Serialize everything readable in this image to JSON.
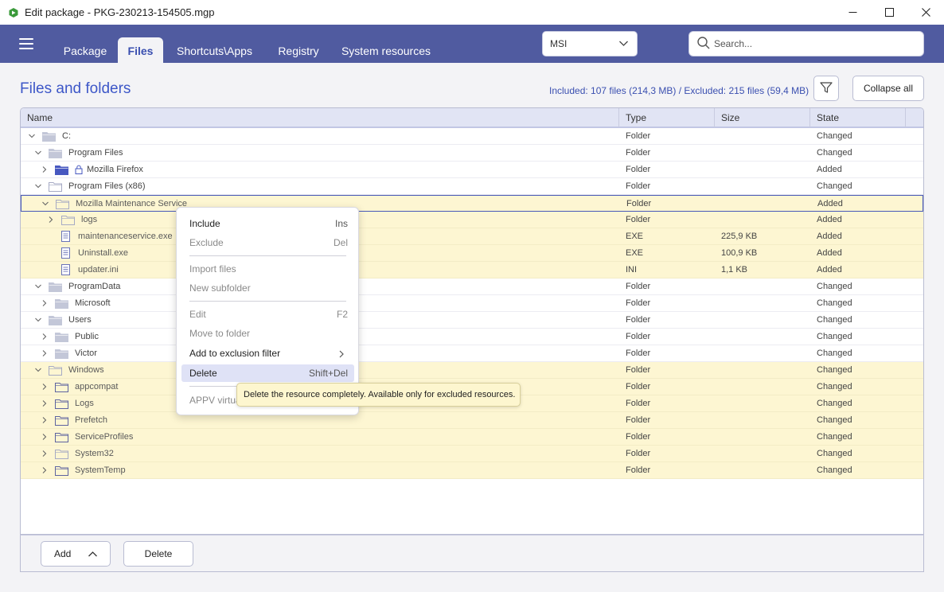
{
  "window": {
    "title": "Edit package - PKG-230213-154505.mgp",
    "min_icon": "minimize-icon",
    "max_icon": "maximize-icon",
    "close_icon": "close-icon"
  },
  "nav": {
    "tabs": [
      {
        "label": "Package",
        "active": false
      },
      {
        "label": "Files",
        "active": true
      },
      {
        "label": "Shortcuts\\Apps",
        "active": false
      },
      {
        "label": "Registry",
        "active": false
      },
      {
        "label": "System resources",
        "active": false
      }
    ],
    "format_select": "MSI",
    "search_placeholder": "Search..."
  },
  "header": {
    "title": "Files and folders",
    "counts": "Included: 107 files (214,3 MB) / Excluded: 215 files (59,4 MB)",
    "collapse_all": "Collapse all"
  },
  "columns": [
    "Name",
    "Type",
    "Size",
    "State"
  ],
  "rows": [
    {
      "name": "C:",
      "type": "Folder",
      "size": "",
      "state": "Changed",
      "level": 0,
      "chev": "down",
      "icon": "folder-grey",
      "hl": false
    },
    {
      "name": "Program Files",
      "type": "Folder",
      "size": "",
      "state": "Changed",
      "level": 1,
      "chev": "down",
      "icon": "folder-grey",
      "hl": false
    },
    {
      "name": "Mozilla Firefox",
      "type": "Folder",
      "size": "",
      "state": "Added",
      "level": 2,
      "chev": "right",
      "icon": "folder-blue",
      "lock": true,
      "hl": false
    },
    {
      "name": "Program Files (x86)",
      "type": "Folder",
      "size": "",
      "state": "Changed",
      "level": 1,
      "chev": "down",
      "icon": "folder-outline",
      "hl": false
    },
    {
      "name": "Mozilla Maintenance Service",
      "type": "Folder",
      "size": "",
      "state": "Added",
      "level": 2,
      "chev": "down",
      "icon": "folder-outline",
      "hl": true,
      "sel": true
    },
    {
      "name": "logs",
      "type": "Folder",
      "size": "",
      "state": "Added",
      "level": 3,
      "chev": "right",
      "icon": "folder-outline",
      "hl": true
    },
    {
      "name": "maintenanceservice.exe",
      "type": "EXE",
      "size": "225,9 KB",
      "state": "Added",
      "level": 3,
      "chev": "",
      "icon": "file",
      "hl": true
    },
    {
      "name": "Uninstall.exe",
      "type": "EXE",
      "size": "100,9 KB",
      "state": "Added",
      "level": 3,
      "chev": "",
      "icon": "file",
      "hl": true
    },
    {
      "name": "updater.ini",
      "type": "INI",
      "size": "1,1 KB",
      "state": "Added",
      "level": 3,
      "chev": "",
      "icon": "file",
      "hl": true
    },
    {
      "name": "ProgramData",
      "type": "Folder",
      "size": "",
      "state": "Changed",
      "level": 1,
      "chev": "down",
      "icon": "folder-grey",
      "hl": false
    },
    {
      "name": "Microsoft",
      "type": "Folder",
      "size": "",
      "state": "Changed",
      "level": 2,
      "chev": "right",
      "icon": "folder-grey",
      "hl": false
    },
    {
      "name": "Users",
      "type": "Folder",
      "size": "",
      "state": "Changed",
      "level": 1,
      "chev": "down",
      "icon": "folder-grey",
      "hl": false
    },
    {
      "name": "Public",
      "type": "Folder",
      "size": "",
      "state": "Changed",
      "level": 2,
      "chev": "right",
      "icon": "folder-grey",
      "hl": false
    },
    {
      "name": "Victor",
      "type": "Folder",
      "size": "",
      "state": "Changed",
      "level": 2,
      "chev": "right",
      "icon": "folder-grey",
      "hl": false
    },
    {
      "name": "Windows",
      "type": "Folder",
      "size": "",
      "state": "Changed",
      "level": 1,
      "chev": "down",
      "icon": "folder-outline",
      "hl": true
    },
    {
      "name": "appcompat",
      "type": "Folder",
      "size": "",
      "state": "Changed",
      "level": 2,
      "chev": "right",
      "icon": "folder-outline-dark",
      "hl": true
    },
    {
      "name": "Logs",
      "type": "Folder",
      "size": "",
      "state": "Changed",
      "level": 2,
      "chev": "right",
      "icon": "folder-outline-dark",
      "hl": true
    },
    {
      "name": "Prefetch",
      "type": "Folder",
      "size": "",
      "state": "Changed",
      "level": 2,
      "chev": "right",
      "icon": "folder-outline-dark",
      "hl": true
    },
    {
      "name": "ServiceProfiles",
      "type": "Folder",
      "size": "",
      "state": "Changed",
      "level": 2,
      "chev": "right",
      "icon": "folder-outline-dark",
      "hl": true
    },
    {
      "name": "System32",
      "type": "Folder",
      "size": "",
      "state": "Changed",
      "level": 2,
      "chev": "right",
      "icon": "folder-outline",
      "hl": true
    },
    {
      "name": "SystemTemp",
      "type": "Folder",
      "size": "",
      "state": "Changed",
      "level": 2,
      "chev": "right",
      "icon": "folder-outline-dark",
      "hl": true
    }
  ],
  "footer": {
    "add": "Add",
    "delete": "Delete"
  },
  "context_menu": {
    "include": {
      "label": "Include",
      "shortcut": "Ins"
    },
    "exclude": {
      "label": "Exclude",
      "shortcut": "Del"
    },
    "import_files": {
      "label": "Import files"
    },
    "new_subfolder": {
      "label": "New subfolder"
    },
    "edit": {
      "label": "Edit",
      "shortcut": "F2"
    },
    "move_to_folder": {
      "label": "Move to folder"
    },
    "add_exclusion": {
      "label": "Add to exclusion filter"
    },
    "delete": {
      "label": "Delete",
      "shortcut": "Shift+Del"
    },
    "appv": {
      "label": "APPV virtua"
    }
  },
  "tooltip": "Delete the resource completely. Available only for excluded resources.",
  "colors": {
    "nav_bg": "#505ba0",
    "accent": "#3d57c8",
    "highlight_row": "#fdf6d2",
    "tooltip_bg": "#fdf6cf"
  }
}
